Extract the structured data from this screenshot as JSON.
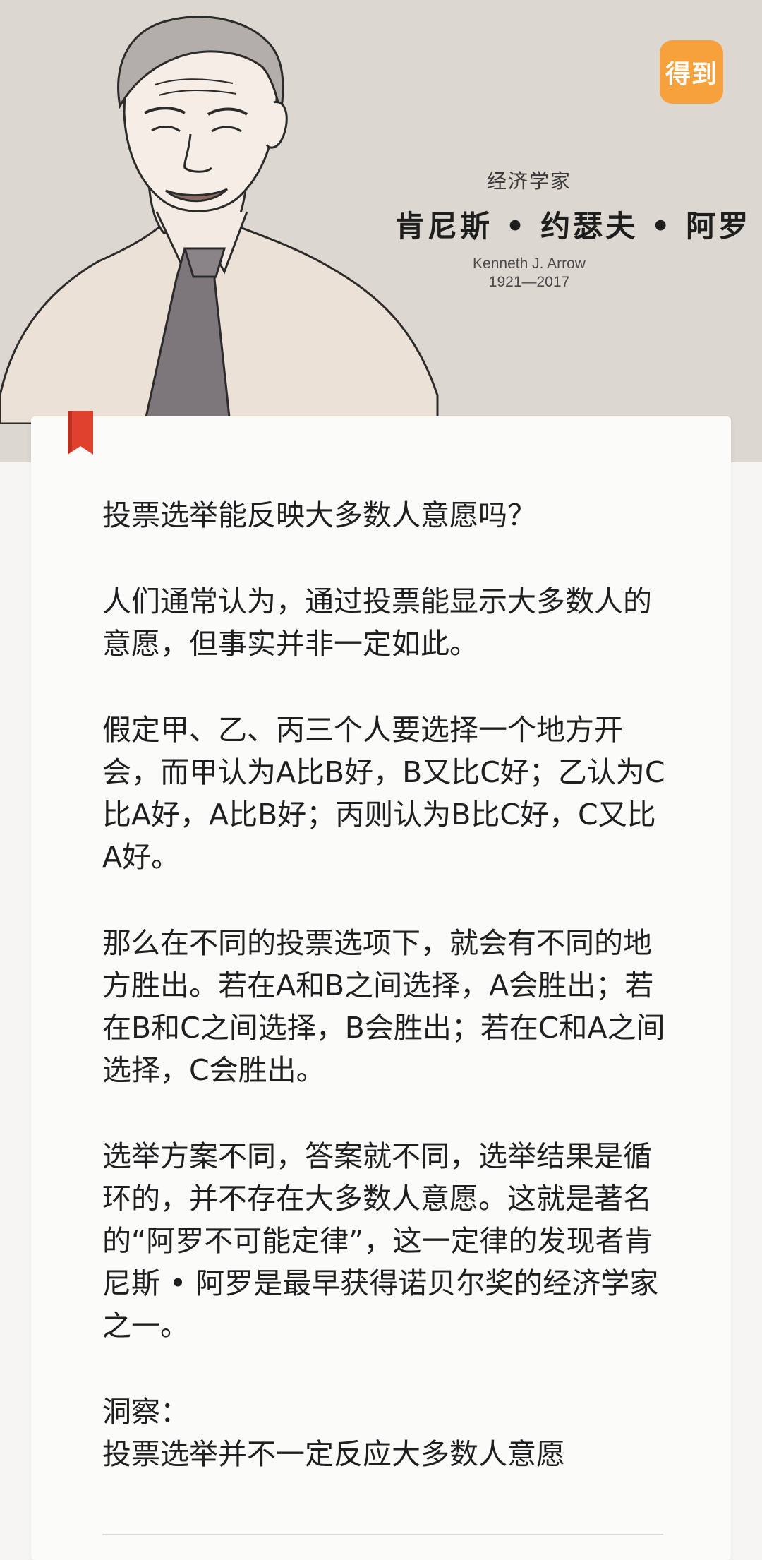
{
  "header": {
    "logo_text": "得到",
    "profession": "经济学家",
    "name": "肯尼斯 • 约瑟夫 • 阿罗",
    "name_en": "Kenneth J. Arrow",
    "years": "1921—2017"
  },
  "article": {
    "title": "投票选举能反映大多数人意愿吗？",
    "paragraphs": [
      "人们通常认为，通过投票能显示大多数人的意愿，但事实并非一定如此。",
      "假定甲、乙、丙三个人要选择一个地方开会，而甲认为A比B好，B又比C好；乙认为C比A好，A比B好；丙则认为B比C好，C又比A好。",
      "那么在不同的投票选项下，就会有不同的地方胜出。若在A和B之间选择，A会胜出；若在B和C之间选择，B会胜出；若在C和A之间选择，C会胜出。",
      "选举方案不同，答案就不同，选举结果是循环的，并不存在大多数人意愿。这就是著名的“阿罗不可能定律”，这一定律的发现者肯尼斯 • 阿罗是最早获得诺贝尔奖的经济学家之一。"
    ],
    "insight_label": "洞察：",
    "insight": "投票选举并不一定反应大多数人意愿"
  },
  "colors": {
    "header_bg": "#dcd7d0",
    "logo_bg": "#f6a13b",
    "bookmark": "#e0412f",
    "card_bg": "#fbfbfa"
  },
  "icons": [
    "economist-portrait-illustration",
    "dedao-logo-icon",
    "bookmark-icon"
  ]
}
